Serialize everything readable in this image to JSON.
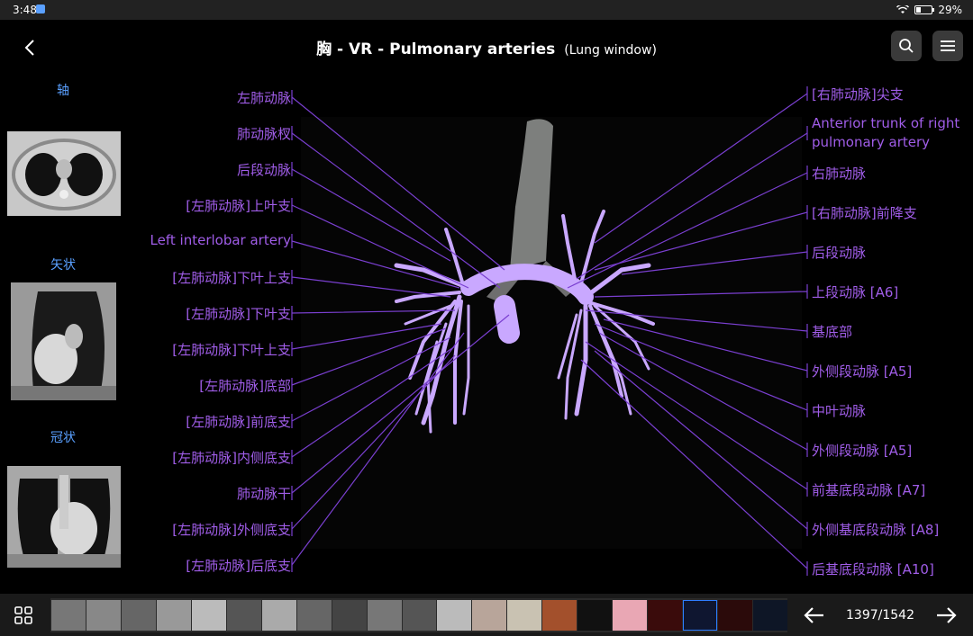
{
  "status_bar": {
    "time": "3:48",
    "battery": "29%",
    "battery_level": 0.29
  },
  "header": {
    "title": "胸 - VR - Pulmonary arteries",
    "subtitle": "(Lung window)"
  },
  "views": {
    "axial_label": "轴",
    "sagittal_label": "矢状",
    "coronal_label": "冠状"
  },
  "left_labels": [
    "左肺动脉",
    "肺动脉杈",
    "后段动脉",
    "[左肺动脉]上叶支",
    "Left interlobar artery",
    "[左肺动脉]下叶上支",
    "[左肺动脉]下叶支",
    "[左肺动脉]下叶上支",
    "[左肺动脉]底部",
    "[左肺动脉]前底支",
    "[左肺动脉]内侧底支",
    "肺动脉干",
    "[左肺动脉]外侧底支",
    "[左肺动脉]后底支"
  ],
  "right_labels": [
    "[右肺动脉]尖支",
    "Anterior trunk of right",
    "pulmonary artery",
    "右肺动脉",
    "[右肺动脉]前降支",
    "后段动脉",
    "上段动脉 [A6]",
    "基底部",
    "外侧段动脉 [A5]",
    "中叶动脉",
    "外侧段动脉 [A5]",
    "前基底段动脉 [A7]",
    "外侧基底段动脉 [A8]",
    "后基底段动脉 [A10]"
  ],
  "pager": {
    "counter": "1397/1542"
  },
  "colors": {
    "accent_blue": "#5aa0ff",
    "label_purple": "#a05de8",
    "vessel": "#c9a8ff"
  },
  "icons": [
    "back-arrow-icon",
    "search-icon",
    "menu-icon",
    "grid-icon",
    "arrow-left-icon",
    "arrow-right-icon",
    "wifi-icon",
    "battery-icon"
  ]
}
